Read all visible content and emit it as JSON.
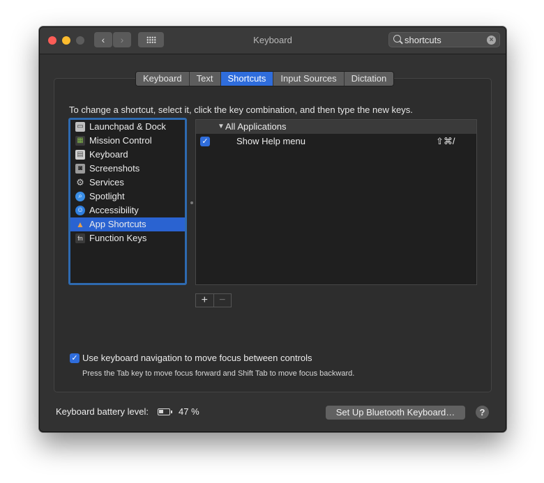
{
  "window": {
    "title": "Keyboard",
    "search": {
      "value": "shortcuts",
      "clear_icon": "×"
    },
    "nav": {
      "back": "‹",
      "forward": "›"
    }
  },
  "tabs": [
    {
      "label": "Keyboard",
      "active": false
    },
    {
      "label": "Text",
      "active": false
    },
    {
      "label": "Shortcuts",
      "active": true
    },
    {
      "label": "Input Sources",
      "active": false
    },
    {
      "label": "Dictation",
      "active": false
    }
  ],
  "instructions": "To change a shortcut, select it, click the key combination, and then type the new keys.",
  "categories": [
    {
      "label": "Launchpad & Dock",
      "icon": "launchpad-icon",
      "color": "#bfbfbf",
      "selected": false
    },
    {
      "label": "Mission Control",
      "icon": "mission-control-icon",
      "color": "#7fb24a",
      "selected": false
    },
    {
      "label": "Keyboard",
      "icon": "keyboard-icon",
      "color": "#cfcfcf",
      "selected": false
    },
    {
      "label": "Screenshots",
      "icon": "screenshot-icon",
      "color": "#9a9a9a",
      "selected": false
    },
    {
      "label": "Services",
      "icon": "gear-icon",
      "color": "#9a9a9a",
      "selected": false
    },
    {
      "label": "Spotlight",
      "icon": "spotlight-icon",
      "color": "#3a8ee6",
      "selected": false
    },
    {
      "label": "Accessibility",
      "icon": "accessibility-icon",
      "color": "#2f7fe0",
      "selected": false
    },
    {
      "label": "App Shortcuts",
      "icon": "app-shortcuts-icon",
      "color": "#d98b3a",
      "selected": true
    },
    {
      "label": "Function Keys",
      "icon": "fn-key-icon",
      "color": "#5a5a5a",
      "selected": false
    }
  ],
  "shortcuts": {
    "group_label": "All Applications",
    "rows": [
      {
        "checked": true,
        "name": "Show Help menu",
        "keys": "⇧⌘/"
      }
    ]
  },
  "buttons": {
    "add": "+",
    "remove": "−",
    "setup_bluetooth": "Set Up Bluetooth Keyboard…",
    "help": "?"
  },
  "keyboard_navigation": {
    "checked": true,
    "label": "Use keyboard navigation to move focus between controls",
    "hint": "Press the Tab key to move focus forward and Shift Tab to move focus backward."
  },
  "battery": {
    "label": "Keyboard battery level:",
    "percent_text": "47 %",
    "level": 0.47
  }
}
